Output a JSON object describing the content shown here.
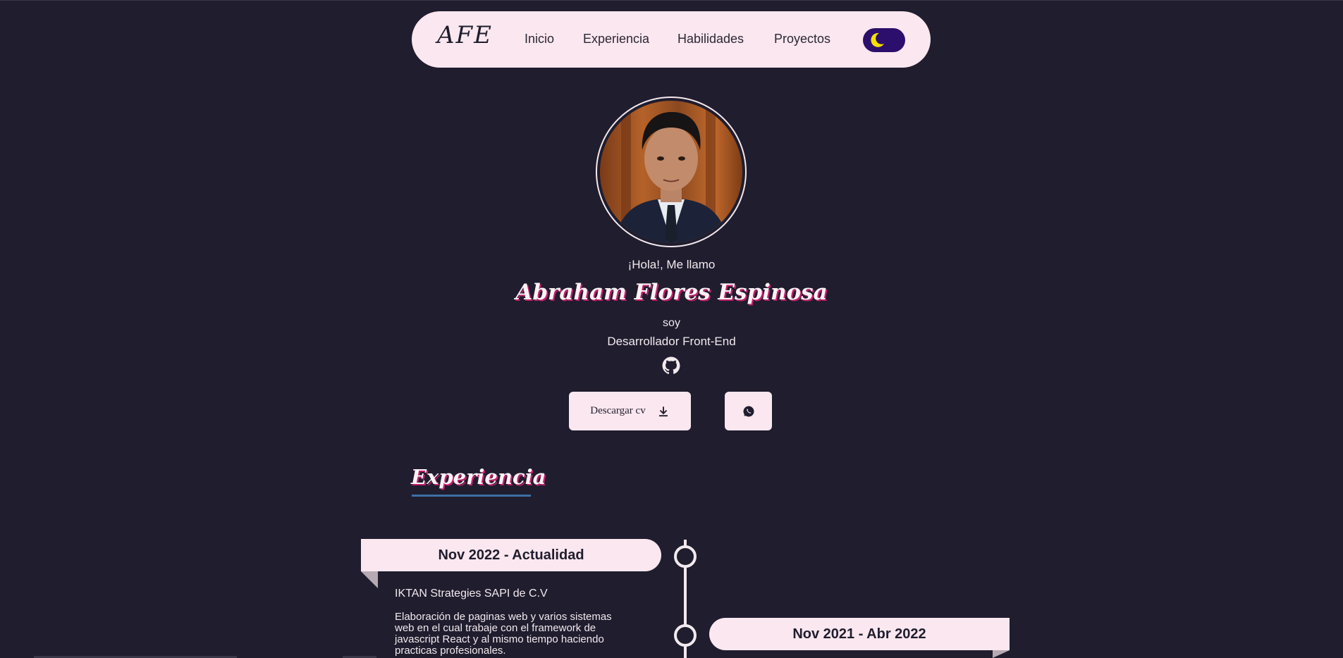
{
  "nav": {
    "logo": "AFE",
    "links": [
      "Inicio",
      "Experiencia",
      "Habilidades",
      "Proyectos"
    ],
    "theme_toggle_icon": "moon-icon"
  },
  "hero": {
    "greeting": "¡Hola!, Me llamo",
    "name": "Abraham Flores Espinosa",
    "soy": "soy",
    "role": "Desarrollador Front-End",
    "github_icon": "github-icon",
    "download_cv_label": "Descargar cv",
    "download_icon": "download-icon",
    "whatsapp_icon": "whatsapp-icon"
  },
  "experience": {
    "title": "Experiencia",
    "items": [
      {
        "date": "Nov 2022 - Actualidad",
        "company": "IKTAN Strategies SAPI de C.V",
        "description": "Elaboración de paginas web y varios sistemas web en el cual trabaje con el framework de javascript React y al mismo tiempo haciendo practicas profesionales."
      },
      {
        "date": "Nov 2021 - Abr 2022"
      }
    ]
  },
  "colors": {
    "background": "#1f1d2e",
    "surface": "#fbe7ef",
    "toggle": "#2c0f6c",
    "accent": "#c21f6a",
    "underline": "#3f6fa5"
  }
}
